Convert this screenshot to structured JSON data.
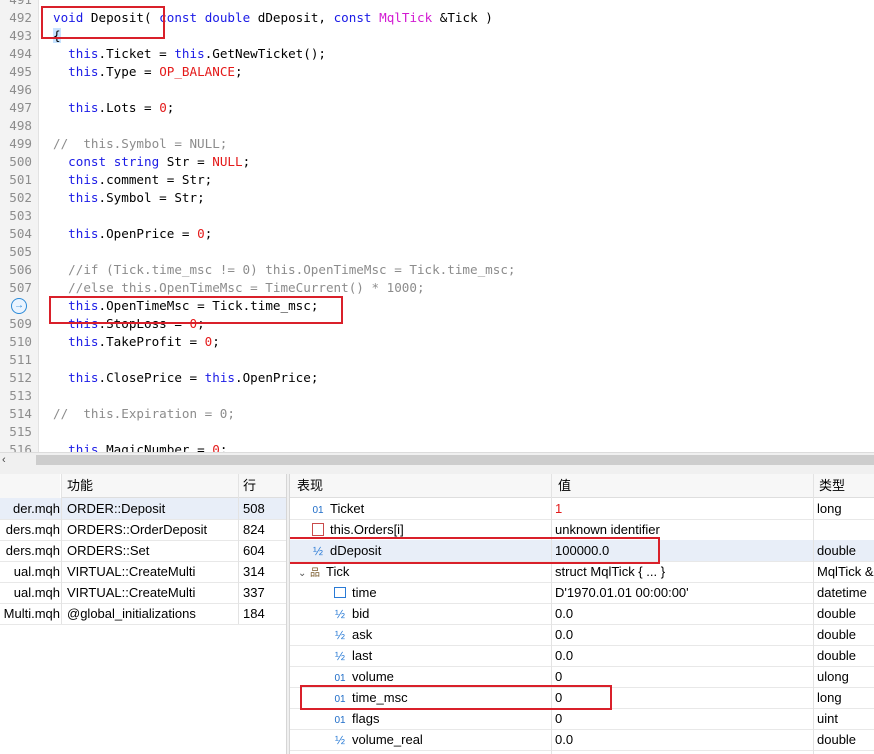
{
  "editor": {
    "lines": [
      {
        "n": "491",
        "segs": []
      },
      {
        "n": "492",
        "segs": [
          {
            "t": "void",
            "c": "kw"
          },
          {
            "t": " Deposit( ",
            "c": "pl"
          },
          {
            "t": "const",
            "c": "kw"
          },
          {
            "t": " ",
            "c": "pl"
          },
          {
            "t": "double",
            "c": "ty"
          },
          {
            "t": " dDeposit, ",
            "c": "pl"
          },
          {
            "t": "const",
            "c": "kw"
          },
          {
            "t": " ",
            "c": "pl"
          },
          {
            "t": "MqlTick",
            "c": "ud"
          },
          {
            "t": " &Tick )",
            "c": "pl"
          }
        ]
      },
      {
        "n": "493",
        "segs": [
          {
            "t": "{",
            "c": "br"
          }
        ]
      },
      {
        "n": "494",
        "segs": [
          {
            "t": "  ",
            "c": "pl"
          },
          {
            "t": "this",
            "c": "kw"
          },
          {
            "t": ".Ticket = ",
            "c": "pl"
          },
          {
            "t": "this",
            "c": "kw"
          },
          {
            "t": ".GetNewTicket();",
            "c": "pl"
          }
        ]
      },
      {
        "n": "495",
        "segs": [
          {
            "t": "  ",
            "c": "pl"
          },
          {
            "t": "this",
            "c": "kw"
          },
          {
            "t": ".Type = ",
            "c": "pl"
          },
          {
            "t": "OP_BALANCE",
            "c": "nu"
          },
          {
            "t": ";",
            "c": "pl"
          }
        ]
      },
      {
        "n": "496",
        "segs": []
      },
      {
        "n": "497",
        "segs": [
          {
            "t": "  ",
            "c": "pl"
          },
          {
            "t": "this",
            "c": "kw"
          },
          {
            "t": ".Lots = ",
            "c": "pl"
          },
          {
            "t": "0",
            "c": "nu"
          },
          {
            "t": ";",
            "c": "pl"
          }
        ]
      },
      {
        "n": "498",
        "segs": []
      },
      {
        "n": "499",
        "segs": [
          {
            "t": "//  this.Symbol = NULL;",
            "c": "cm"
          }
        ]
      },
      {
        "n": "500",
        "segs": [
          {
            "t": "  ",
            "c": "pl"
          },
          {
            "t": "const",
            "c": "kw"
          },
          {
            "t": " ",
            "c": "pl"
          },
          {
            "t": "string",
            "c": "ty"
          },
          {
            "t": " Str = ",
            "c": "pl"
          },
          {
            "t": "NULL",
            "c": "nu"
          },
          {
            "t": ";",
            "c": "pl"
          }
        ]
      },
      {
        "n": "501",
        "segs": [
          {
            "t": "  ",
            "c": "pl"
          },
          {
            "t": "this",
            "c": "kw"
          },
          {
            "t": ".comment = Str;",
            "c": "pl"
          }
        ]
      },
      {
        "n": "502",
        "segs": [
          {
            "t": "  ",
            "c": "pl"
          },
          {
            "t": "this",
            "c": "kw"
          },
          {
            "t": ".Symbol = Str;",
            "c": "pl"
          }
        ]
      },
      {
        "n": "503",
        "segs": []
      },
      {
        "n": "504",
        "segs": [
          {
            "t": "  ",
            "c": "pl"
          },
          {
            "t": "this",
            "c": "kw"
          },
          {
            "t": ".OpenPrice = ",
            "c": "pl"
          },
          {
            "t": "0",
            "c": "nu"
          },
          {
            "t": ";",
            "c": "pl"
          }
        ]
      },
      {
        "n": "505",
        "segs": []
      },
      {
        "n": "506",
        "segs": [
          {
            "t": "  //if (Tick.time_msc != 0) this.OpenTimeMsc = Tick.time_msc;",
            "c": "cm"
          }
        ]
      },
      {
        "n": "507",
        "segs": [
          {
            "t": "  //else this.OpenTimeMsc = TimeCurrent() * 1000;",
            "c": "cm"
          }
        ]
      },
      {
        "n": "",
        "segs": [
          {
            "t": "  ",
            "c": "pl"
          },
          {
            "t": "this",
            "c": "kw"
          },
          {
            "t": ".OpenTimeMsc = Tick.time_msc;",
            "c": "pl"
          }
        ]
      },
      {
        "n": "509",
        "segs": [
          {
            "t": "  ",
            "c": "pl"
          },
          {
            "t": "this",
            "c": "kw"
          },
          {
            "t": ".StopLoss = ",
            "c": "pl"
          },
          {
            "t": "0",
            "c": "nu"
          },
          {
            "t": ";",
            "c": "pl"
          }
        ]
      },
      {
        "n": "510",
        "segs": [
          {
            "t": "  ",
            "c": "pl"
          },
          {
            "t": "this",
            "c": "kw"
          },
          {
            "t": ".TakeProfit = ",
            "c": "pl"
          },
          {
            "t": "0",
            "c": "nu"
          },
          {
            "t": ";",
            "c": "pl"
          }
        ]
      },
      {
        "n": "511",
        "segs": []
      },
      {
        "n": "512",
        "segs": [
          {
            "t": "  ",
            "c": "pl"
          },
          {
            "t": "this",
            "c": "kw"
          },
          {
            "t": ".ClosePrice = ",
            "c": "pl"
          },
          {
            "t": "this",
            "c": "kw"
          },
          {
            "t": ".OpenPrice;",
            "c": "pl"
          }
        ]
      },
      {
        "n": "513",
        "segs": []
      },
      {
        "n": "514",
        "segs": [
          {
            "t": "//  this.Expiration = 0;",
            "c": "cm"
          }
        ]
      },
      {
        "n": "515",
        "segs": []
      },
      {
        "n": "516",
        "segs": [
          {
            "t": "  ",
            "c": "pl"
          },
          {
            "t": "this",
            "c": "kw"
          },
          {
            "t": ".MagicNumber = ",
            "c": "pl"
          },
          {
            "t": "0",
            "c": "nu"
          },
          {
            "t": ";",
            "c": "pl"
          }
        ]
      }
    ],
    "current_line_icon": "→",
    "hscroll_left_icon": "‹"
  },
  "callstack": {
    "headers": {
      "file": "",
      "func": "功能",
      "line": "行"
    },
    "rows": [
      {
        "file": "der.mqh",
        "func": "ORDER::Deposit",
        "line": "508",
        "selected": true
      },
      {
        "file": "ders.mqh",
        "func": "ORDERS::OrderDeposit",
        "line": "824",
        "selected": false
      },
      {
        "file": "ders.mqh",
        "func": "ORDERS::Set",
        "line": "604",
        "selected": false
      },
      {
        "file": "ual.mqh",
        "func": "VIRTUAL::CreateMulti",
        "line": "314",
        "selected": false
      },
      {
        "file": "ual.mqh",
        "func": "VIRTUAL::CreateMulti",
        "line": "337",
        "selected": false
      },
      {
        "file": "Multi.mqh",
        "func": "@global_initializations",
        "line": "184",
        "selected": false
      }
    ]
  },
  "watch": {
    "headers": {
      "expr": "表现",
      "value": "值",
      "type": "类型"
    },
    "rows": [
      {
        "icon": "01",
        "indent": 0,
        "expand": "",
        "name": "Ticket",
        "value": "1",
        "type": "long",
        "selected": false,
        "value_red": true
      },
      {
        "icon": "doc",
        "indent": 0,
        "expand": "",
        "name": "this.Orders[i]",
        "value": "unknown identifier",
        "type": "",
        "selected": false,
        "value_red": false
      },
      {
        "icon": "½",
        "indent": 0,
        "expand": "",
        "name": "dDeposit",
        "value": "100000.0",
        "type": "double",
        "selected": true,
        "value_red": false
      },
      {
        "icon": "struct",
        "indent": 0,
        "expand": "⌄",
        "name": "Tick",
        "value": "struct MqlTick { ... }",
        "type": "MqlTick &",
        "selected": false,
        "value_red": false
      },
      {
        "icon": "cal",
        "indent": 1,
        "expand": "",
        "name": "time",
        "value": "D'1970.01.01 00:00:00'",
        "type": "datetime",
        "selected": false,
        "value_red": false
      },
      {
        "icon": "½",
        "indent": 1,
        "expand": "",
        "name": "bid",
        "value": "0.0",
        "type": "double",
        "selected": false,
        "value_red": false
      },
      {
        "icon": "½",
        "indent": 1,
        "expand": "",
        "name": "ask",
        "value": "0.0",
        "type": "double",
        "selected": false,
        "value_red": false
      },
      {
        "icon": "½",
        "indent": 1,
        "expand": "",
        "name": "last",
        "value": "0.0",
        "type": "double",
        "selected": false,
        "value_red": false
      },
      {
        "icon": "01",
        "indent": 1,
        "expand": "",
        "name": "volume",
        "value": "0",
        "type": "ulong",
        "selected": false,
        "value_red": false
      },
      {
        "icon": "01",
        "indent": 1,
        "expand": "",
        "name": "time_msc",
        "value": "0",
        "type": "long",
        "selected": false,
        "value_red": false
      },
      {
        "icon": "01",
        "indent": 1,
        "expand": "",
        "name": "flags",
        "value": "0",
        "type": "uint",
        "selected": false,
        "value_red": false
      },
      {
        "icon": "½",
        "indent": 1,
        "expand": "",
        "name": "volume_real",
        "value": "0.0",
        "type": "double",
        "selected": false,
        "value_red": false
      }
    ]
  },
  "colors": {
    "keyword": "#1a1ae6",
    "type_user": "#d21ad2",
    "literal": "#e41a1a",
    "comment": "#8c8c8c",
    "annotation": "#d9202a",
    "selection": "#e8eef8"
  }
}
